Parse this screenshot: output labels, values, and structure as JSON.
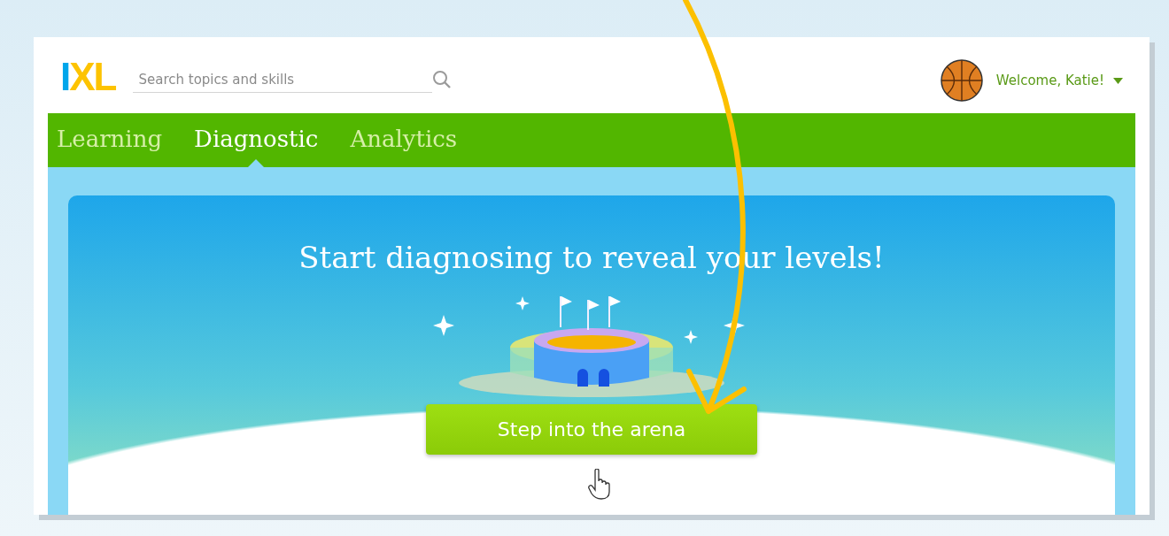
{
  "logo": {
    "text": "IXL"
  },
  "search": {
    "placeholder": "Search topics and skills"
  },
  "user": {
    "greeting": "Welcome, Katie!"
  },
  "tabs": [
    {
      "label": "Learning",
      "selected": false
    },
    {
      "label": "Diagnostic",
      "selected": true
    },
    {
      "label": "Analytics",
      "selected": false
    }
  ],
  "banner": {
    "title": "Start diagnosing to reveal your levels!",
    "button": "Step into the arena"
  }
}
